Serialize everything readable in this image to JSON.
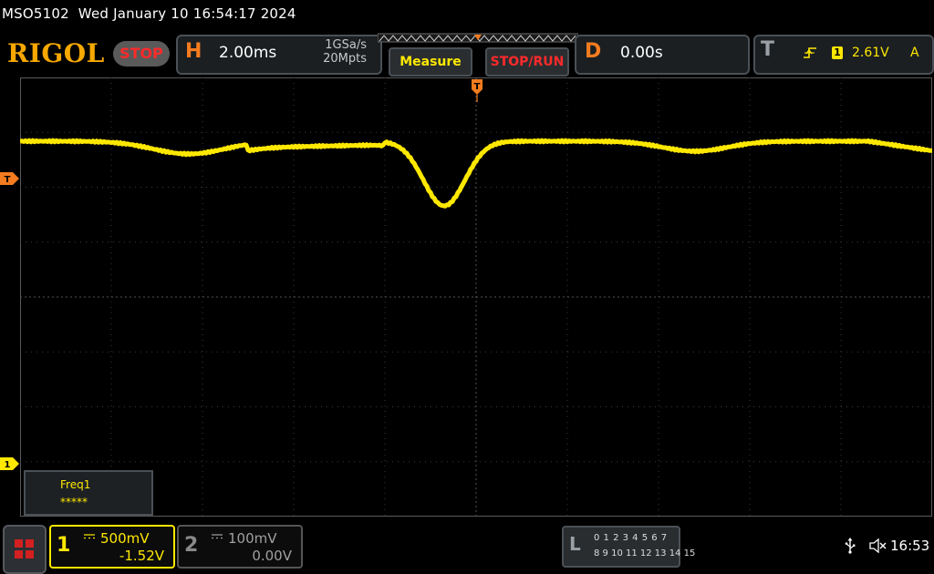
{
  "header": {
    "model": "MSO5102",
    "datetime": "Wed January 10 16:54:17 2024",
    "logo": "RIGOL",
    "run_state": "STOP"
  },
  "horizontal": {
    "letter": "H",
    "timebase": "2.00ms",
    "sample_rate": "1GSa/s",
    "memory_depth": "20Mpts"
  },
  "buttons": {
    "measure": "Measure",
    "stop_run": "STOP/RUN"
  },
  "delay": {
    "letter": "D",
    "value": "0.00s"
  },
  "trigger": {
    "letter": "T",
    "edge_icon": "rising-edge-icon",
    "source": "1",
    "level": "2.61V",
    "mode": "A",
    "marker_label": "T"
  },
  "measurement": {
    "name": "Freq1",
    "value": "*****"
  },
  "channel1": {
    "number": "1",
    "scale": "500mV",
    "offset": "-1.52V",
    "color": "#ffe800",
    "marker_label": "1"
  },
  "channel2": {
    "number": "2",
    "scale": "100mV",
    "offset": "0.00V",
    "color": "#8a8a8a"
  },
  "logic_analyzer": {
    "letter": "L",
    "row1": "0 1 2 3  4 5 6 7",
    "row2": "8 9 10 11 12 13 14 15"
  },
  "status": {
    "usb_icon": "usb-icon",
    "speaker_icon": "speaker-muted-icon",
    "time": "16:53"
  },
  "colors": {
    "trace": "#ffe800",
    "accent": "#f57c1f",
    "stop": "#ff2a2a",
    "logo": "#f7a800"
  }
}
